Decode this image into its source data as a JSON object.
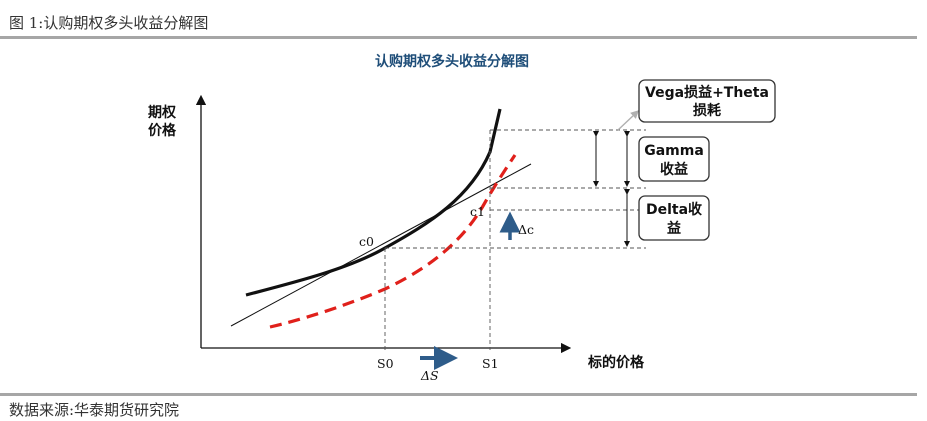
{
  "figure_caption": "图 1:认购期权多头收益分解图",
  "source_caption": "数据来源:华泰期货研究院",
  "diagram": {
    "title": "认购期权多头收益分解图",
    "y_axis_label_line1": "期权",
    "y_axis_label_line2": "价格",
    "x_axis_label": "标的价格",
    "point_c0": "c0",
    "point_c1": "c1",
    "tick_s0": "S0",
    "tick_s1": "S1",
    "delta_c": "Δc",
    "delta_s": "ΔS",
    "box_vega_line1": "Vega损益+Theta",
    "box_vega_line2": "损耗",
    "box_gamma_line1": "Gamma",
    "box_gamma_line2": "收益",
    "box_delta_line1": "Delta收",
    "box_delta_line2": "益"
  },
  "colors": {
    "title": "#1f4e79",
    "dashed_curve": "#e0201b",
    "arrows_blue": "#2e5c8a",
    "rules": "#a6a6a6"
  }
}
